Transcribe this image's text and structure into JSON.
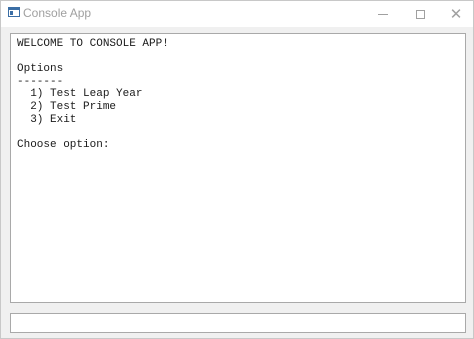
{
  "window": {
    "title": "Console App",
    "icon": "console-app-icon",
    "controls": {
      "minimize": "minimize-icon",
      "maximize": "maximize-icon",
      "close": "close-icon",
      "close_glyph": "✕"
    }
  },
  "console": {
    "lines": [
      "WELCOME TO CONSOLE APP!",
      "",
      "Options",
      "-------",
      "  1) Test Leap Year",
      "  2) Test Prime",
      "  3) Exit",
      "",
      "Choose option:"
    ]
  },
  "input": {
    "value": "",
    "placeholder": ""
  },
  "colors": {
    "title_text": "#a0a0a0",
    "console_bg": "#ffffff",
    "window_bg": "#f0f0f0",
    "border": "#a9a9a9"
  }
}
